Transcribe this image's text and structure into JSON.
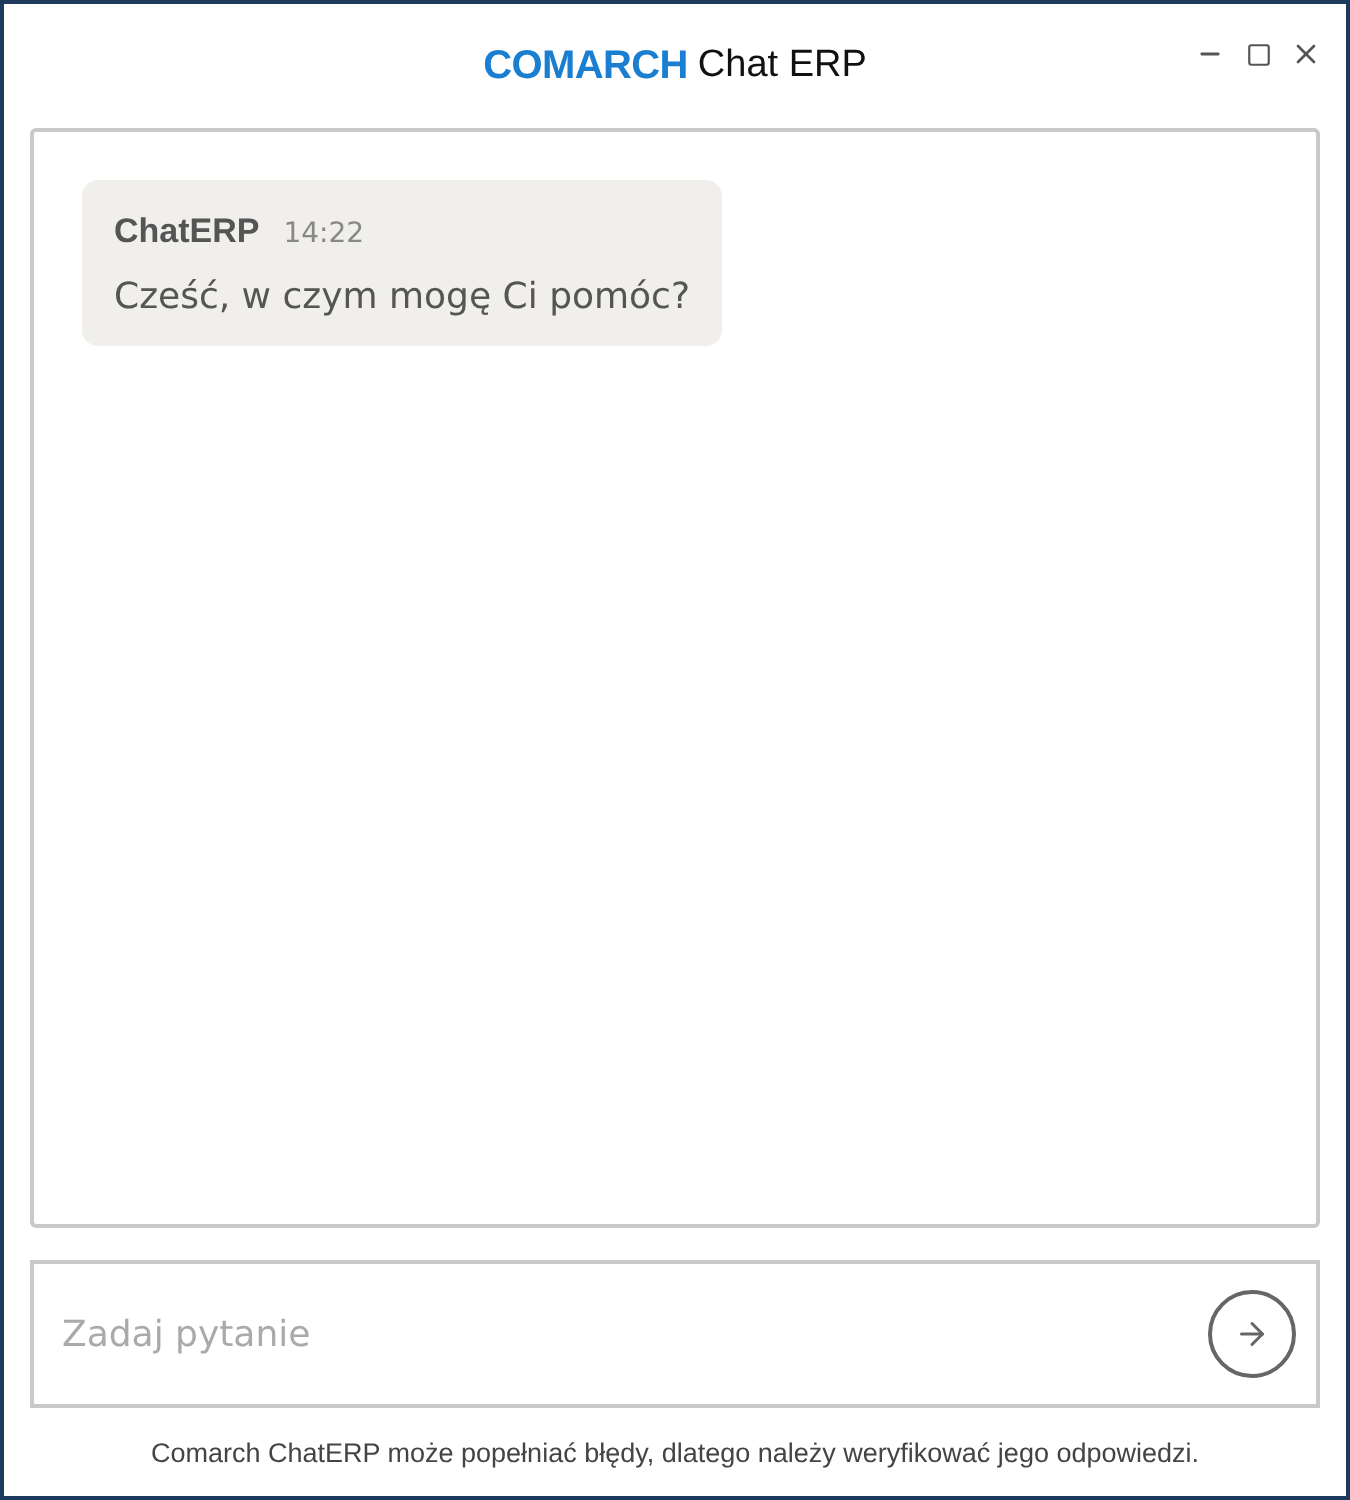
{
  "window": {
    "brand": "COMARCH",
    "title": "Chat ERP"
  },
  "messages": [
    {
      "author": "ChatERP",
      "time": "14:22",
      "text": "Cześć, w czym mogę Ci pomóc?"
    }
  ],
  "input": {
    "placeholder": "Zadaj pytanie"
  },
  "disclaimer": "Comarch ChatERP może popełniać błędy, dlatego należy weryfikować jego odpowiedzi."
}
